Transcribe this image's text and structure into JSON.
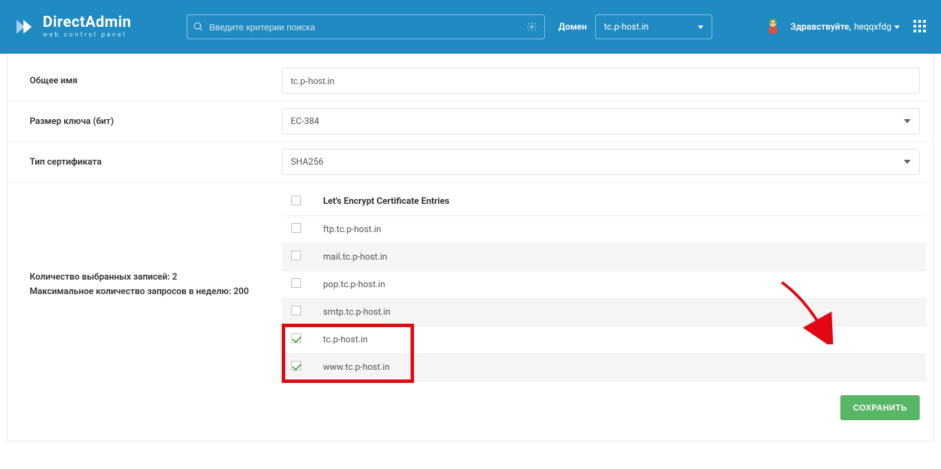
{
  "header": {
    "logo_title": "DirectAdmin",
    "logo_sub": "web control panel",
    "search_placeholder": "Введите критерии поиска",
    "domain_label": "Домен",
    "domain_value": "tc.p-host.in",
    "greeting": "Здравствуйте,",
    "username": "heqqxfdg"
  },
  "form": {
    "common_name_label": "Общее имя",
    "common_name_value": "tc.p-host.in",
    "key_size_label": "Размер ключа (бит)",
    "key_size_value": "EC-384",
    "cert_type_label": "Тип сертификата",
    "cert_type_value": "SHA256"
  },
  "info": {
    "selected_count": "Количество выбранных записей: 2",
    "max_requests": "Максимальное количество запросов в неделю: 200"
  },
  "table": {
    "header": "Let's Encrypt Certificate Entries",
    "entries": [
      {
        "checked": false,
        "name": "ftp.tc.p-host.in"
      },
      {
        "checked": false,
        "name": "mail.tc.p-host.in"
      },
      {
        "checked": false,
        "name": "pop.tc.p-host.in"
      },
      {
        "checked": false,
        "name": "smtp.tc.p-host.in"
      },
      {
        "checked": true,
        "name": "tc.p-host.in"
      },
      {
        "checked": true,
        "name": "www.tc.p-host.in"
      }
    ]
  },
  "actions": {
    "save": "СОХРАНИТЬ"
  },
  "colors": {
    "primary": "#1f8bc2",
    "accent": "#58b766",
    "highlight": "#e30613"
  }
}
